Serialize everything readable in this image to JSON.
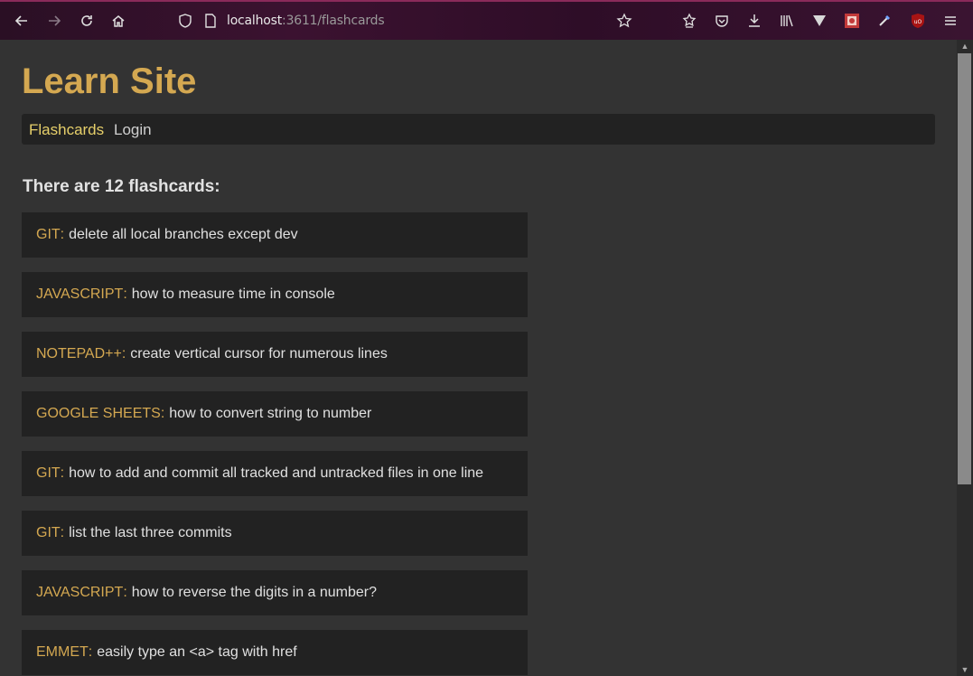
{
  "browser": {
    "url_host": "localhost",
    "url_rest": ":3611/flashcards"
  },
  "site": {
    "title": "Learn Site",
    "nav": {
      "flashcards": "Flashcards",
      "login": "Login"
    }
  },
  "summary": "There are 12 flashcards:",
  "flashcards": [
    {
      "category": "GIT",
      "question": "delete all local branches except dev"
    },
    {
      "category": "JAVASCRIPT",
      "question": "how to measure time in console"
    },
    {
      "category": "NOTEPAD++",
      "question": "create vertical cursor for numerous lines"
    },
    {
      "category": "GOOGLE SHEETS",
      "question": "how to convert string to number"
    },
    {
      "category": "GIT",
      "question": "how to add and commit all tracked and untracked files in one line"
    },
    {
      "category": "GIT",
      "question": "list the last three commits"
    },
    {
      "category": "JAVASCRIPT",
      "question": "how to reverse the digits in a number?"
    },
    {
      "category": "EMMET",
      "question": "easily type an <a> tag with href"
    }
  ],
  "colors": {
    "accent": "#d4a851",
    "nav_active": "#e6cf6a",
    "card_bg": "#222222",
    "page_bg": "#333333"
  }
}
